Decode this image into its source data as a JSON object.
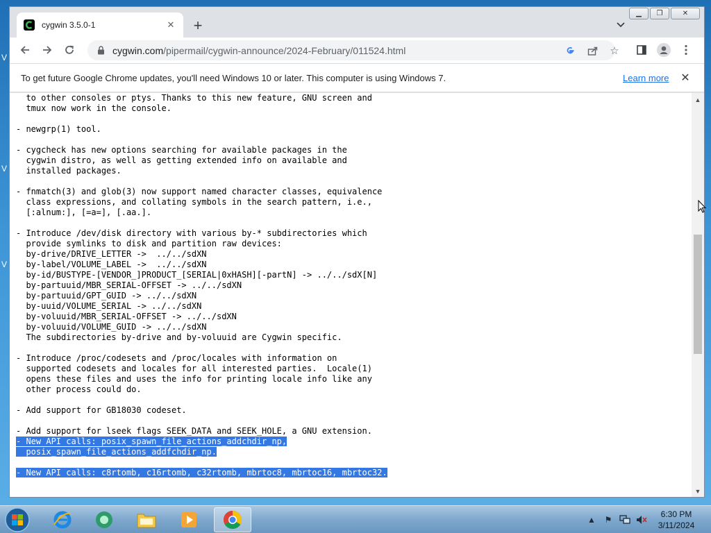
{
  "desktop": {
    "fragments": [
      "V",
      "V",
      "V"
    ]
  },
  "tab": {
    "title": "cygwin 3.5.0-1"
  },
  "omnibox": {
    "host": "cygwin.com",
    "path": "/pipermail/cygwin-announce/2024-February/011524.html"
  },
  "infobar": {
    "message": "To get future Google Chrome updates, you'll need Windows 10 or later. This computer is using Windows 7.",
    "link": "Learn more"
  },
  "content": {
    "lines": [
      "  to other consoles or ptys. Thanks to this new feature, GNU screen and",
      "  tmux now work in the console.",
      "",
      "- newgrp(1) tool.",
      "",
      "- cygcheck has new options searching for available packages in the",
      "  cygwin distro, as well as getting extended info on available and",
      "  installed packages.",
      "",
      "- fnmatch(3) and glob(3) now support named character classes, equivalence",
      "  class expressions, and collating symbols in the search pattern, i.e.,",
      "  [:alnum:], [=a=], [.aa.].",
      "",
      "- Introduce /dev/disk directory with various by-* subdirectories which",
      "  provide symlinks to disk and partition raw devices:",
      "  by-drive/DRIVE_LETTER ->  ../../sdXN",
      "  by-label/VOLUME_LABEL ->  ../../sdXN",
      "  by-id/BUSTYPE-[VENDOR_]PRODUCT_[SERIAL|0xHASH][-partN] -> ../../sdX[N]",
      "  by-partuuid/MBR_SERIAL-OFFSET -> ../../sdXN",
      "  by-partuuid/GPT_GUID -> ../../sdXN",
      "  by-uuid/VOLUME_SERIAL -> ../../sdXN",
      "  by-voluuid/MBR_SERIAL-OFFSET -> ../../sdXN",
      "  by-voluuid/VOLUME_GUID -> ../../sdXN",
      "  The subdirectories by-drive and by-voluuid are Cygwin specific.",
      "",
      "- Introduce /proc/codesets and /proc/locales with information on",
      "  supported codesets and locales for all interested parties.  Locale(1)",
      "  opens these files and uses the info for printing locale info like any",
      "  other process could do.",
      "",
      "- Add support for GB18030 codeset.",
      "",
      "- Add support for lseek flags SEEK_DATA and SEEK_HOLE, a GNU extension."
    ],
    "highlighted": [
      "- New API calls: posix_spawn_file_actions_addchdir_np,",
      "  posix_spawn_file_actions_addfchdir_np.",
      "",
      "- New API calls: c8rtomb, c16rtomb, c32rtomb, mbrtoc8, mbrtoc16, mbrtoc32."
    ]
  },
  "clock": {
    "time": "6:30 PM",
    "date": "3/11/2024"
  },
  "colors": {
    "selection": "#3478e4",
    "link": "#1a73e8"
  }
}
